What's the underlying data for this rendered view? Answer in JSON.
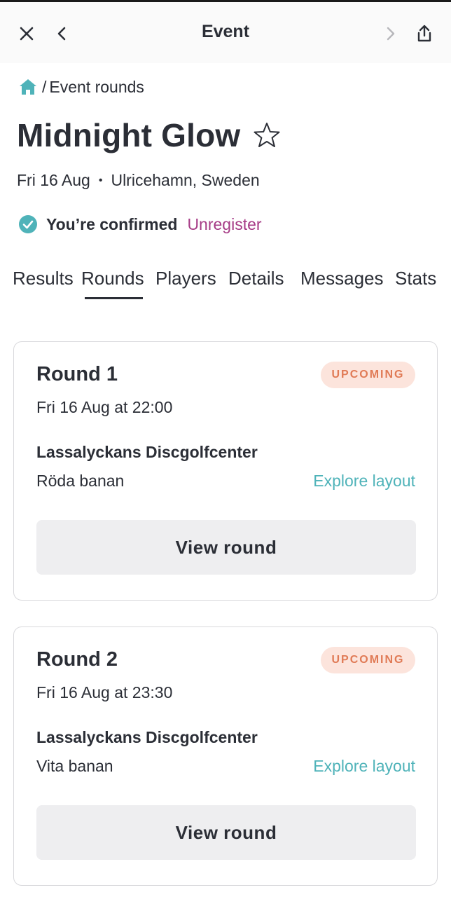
{
  "header": {
    "title": "Event",
    "close_icon": "close-icon",
    "back_icon": "chevron-left-icon",
    "forward_icon": "chevron-right-icon",
    "share_icon": "share-icon"
  },
  "breadcrumb": {
    "home_icon": "home-icon",
    "separator": "/",
    "current": "Event rounds"
  },
  "event": {
    "title": "Midnight Glow",
    "date": "Fri 16 Aug",
    "dot": "•",
    "location": "Ulricehamn, Sweden",
    "status_label": "You’re confirmed",
    "unregister_label": "Unregister"
  },
  "tabs": [
    {
      "label": "Results"
    },
    {
      "label": "Rounds",
      "active": true
    },
    {
      "label": "Players"
    },
    {
      "label": "Details"
    },
    {
      "label": "Messages"
    },
    {
      "label": "Stats"
    }
  ],
  "rounds": [
    {
      "title": "Round 1",
      "status": "UPCOMING",
      "datetime": "Fri 16 Aug at 22:00",
      "course": "Lassalyckans Discgolfcenter",
      "layout": "Röda banan",
      "explore_label": "Explore layout",
      "button_label": "View round"
    },
    {
      "title": "Round 2",
      "status": "UPCOMING",
      "datetime": "Fri 16 Aug at 23:30",
      "course": "Lassalyckans Discgolfcenter",
      "layout": "Vita banan",
      "explore_label": "Explore layout",
      "button_label": "View round"
    }
  ],
  "colors": {
    "accent_teal": "#4fb3b9",
    "unregister": "#a63b86",
    "badge_bg": "#fce4dc",
    "badge_text": "#e07a55",
    "text": "#2b2e36"
  }
}
